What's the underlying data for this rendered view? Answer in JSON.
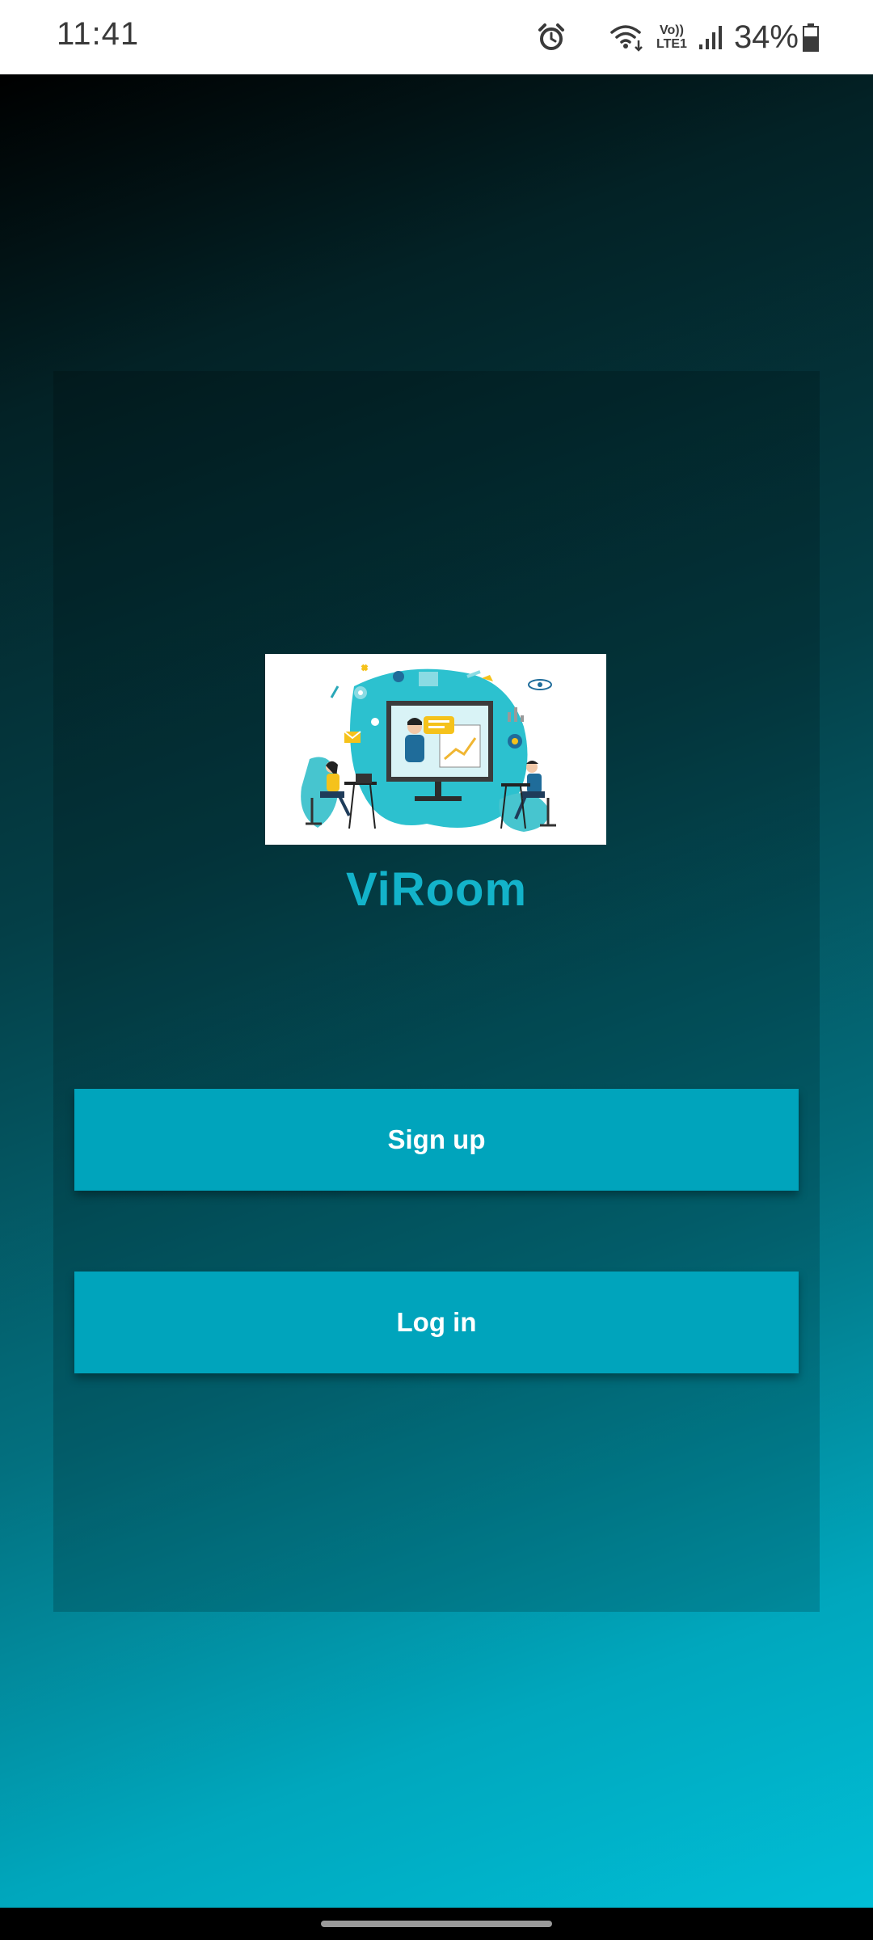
{
  "status_bar": {
    "time": "11:41",
    "lte_line1": "Vo))",
    "lte_line2": "LTE1",
    "battery": "34%",
    "icons": [
      "alarm-icon",
      "wifi-icon",
      "signal-icon",
      "battery-icon"
    ]
  },
  "app": {
    "name": "ViRoom",
    "hero_image": "teaching-illustration"
  },
  "actions": {
    "signup_label": "Sign up",
    "login_label": "Log in"
  },
  "colors": {
    "accent": "#00a4bc",
    "title": "#13b3ca",
    "background_start": "#000000",
    "background_end": "#01bed6"
  }
}
